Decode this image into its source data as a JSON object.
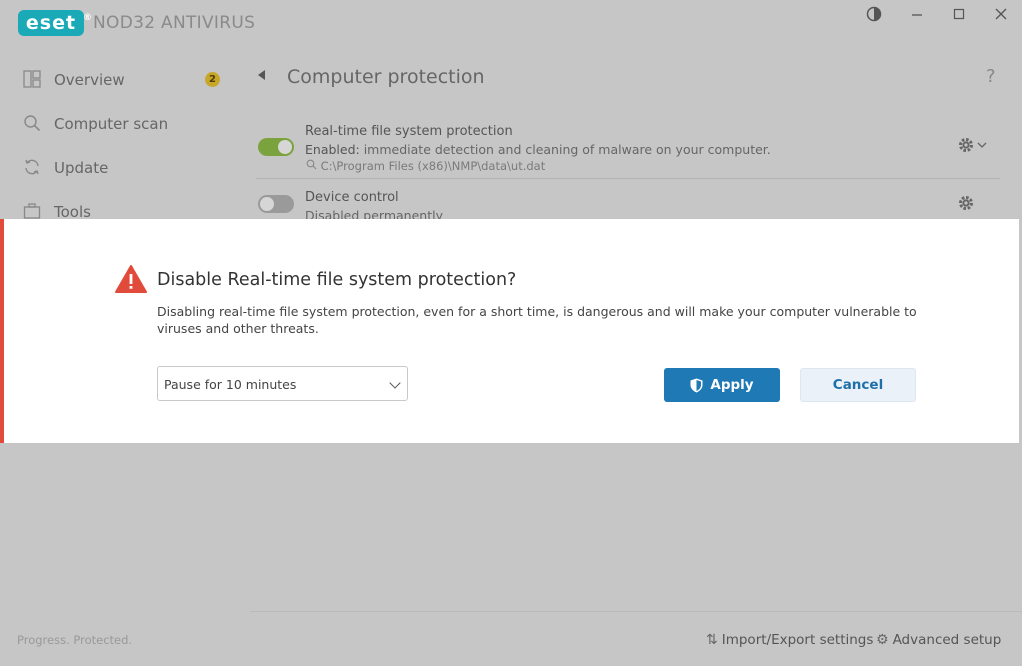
{
  "app": {
    "logo": "eset",
    "product": "NOD32 ANTIVIRUS",
    "colors": {
      "logo": "#1aa9b6",
      "apply": "#1f79b5",
      "warning": "#e14b3b",
      "toggle_on": "#7aa33d"
    }
  },
  "window": {
    "theme_icon": "contrast-icon",
    "minimize": "minimize-icon",
    "maximize": "maximize-icon",
    "close": "close-icon"
  },
  "sidebar": {
    "items": [
      {
        "label": "Overview",
        "icon": "overview-icon",
        "badge": "2"
      },
      {
        "label": "Computer scan",
        "icon": "search-icon"
      },
      {
        "label": "Update",
        "icon": "refresh-icon"
      },
      {
        "label": "Tools",
        "icon": "briefcase-icon"
      }
    ]
  },
  "main": {
    "title": "Computer protection",
    "help": "?",
    "rows": [
      {
        "title": "Real-time file system protection",
        "desc_strong": "Enabled:",
        "desc": " immediate detection and cleaning of malware on your computer.",
        "path": "C:\\Program Files (x86)\\NMP\\data\\ut.dat",
        "enabled": true
      },
      {
        "title": "Device control",
        "desc": "Disabled permanently",
        "enabled": false
      }
    ]
  },
  "footer": {
    "status": "Progress. Protected.",
    "import_export": "Import/Export settings",
    "advanced": "Advanced setup"
  },
  "dialog": {
    "title": "Disable Real-time file system protection?",
    "body": "Disabling real-time file system protection, even for a short time, is dangerous and will make your computer vulnerable to viruses and other threats.",
    "select_value": "Pause for 10 minutes",
    "apply": "Apply",
    "cancel": "Cancel"
  }
}
